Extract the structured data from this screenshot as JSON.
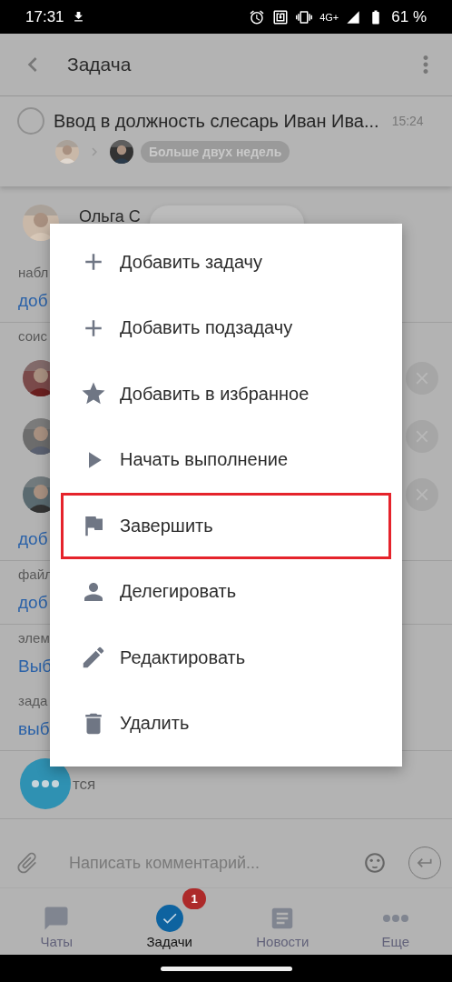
{
  "status_bar": {
    "time": "17:31",
    "network": "4G+",
    "battery": "61 %"
  },
  "header": {
    "title": "Задача"
  },
  "task": {
    "title": "Ввод в должность слесарь Иван Ива...",
    "time": "15:24",
    "deadline": "Больше двух недель",
    "done": false
  },
  "author": {
    "name": "Ольга С"
  },
  "sections": [
    {
      "label": "набл",
      "action": "доб",
      "divider": true
    },
    {
      "label": "соис",
      "action": "доб",
      "divider": true
    },
    {
      "label": "файл",
      "action": "доб",
      "divider": true
    },
    {
      "label": "элем",
      "action": "Выб",
      "divider": false
    },
    {
      "label": "зада",
      "action": "выб",
      "divider": true
    }
  ],
  "likes": {
    "label": "тся"
  },
  "menu": [
    {
      "label": "Добавить задачу",
      "highlighted": false
    },
    {
      "label": "Добавить подзадачу",
      "highlighted": false
    },
    {
      "label": "Добавить в избранное",
      "highlighted": false
    },
    {
      "label": "Начать выполнение",
      "highlighted": false
    },
    {
      "label": "Завершить",
      "highlighted": true
    },
    {
      "label": "Делегировать",
      "highlighted": false
    },
    {
      "label": "Редактировать",
      "highlighted": false
    },
    {
      "label": "Удалить",
      "highlighted": false
    }
  ],
  "comment": {
    "placeholder": "Написать комментарий..."
  },
  "tabs": [
    {
      "label": "Чаты",
      "selected": false
    },
    {
      "label": "Задачи",
      "selected": true,
      "badge": "1"
    },
    {
      "label": "Новости",
      "selected": false
    },
    {
      "label": "Еще",
      "selected": false
    }
  ]
}
